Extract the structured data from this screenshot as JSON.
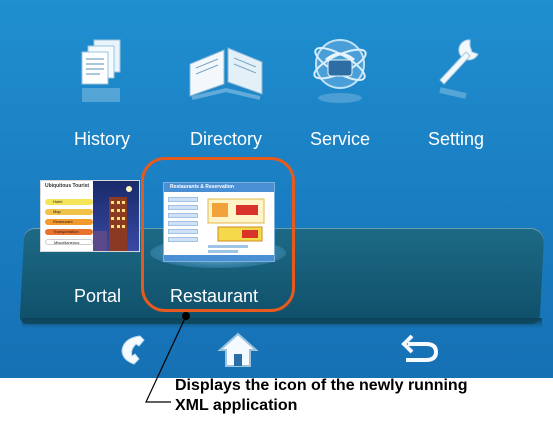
{
  "menu": {
    "items": [
      {
        "label": "History",
        "icon": "documents-stack-icon"
      },
      {
        "label": "Directory",
        "icon": "open-book-icon"
      },
      {
        "label": "Service",
        "icon": "globe-phone-icon"
      },
      {
        "label": "Setting",
        "icon": "wrench-icon"
      }
    ]
  },
  "apps": {
    "portal": {
      "label": "Portal",
      "thumb_title": "Ubiquitous Tourist",
      "thumb_items": [
        "Hotel",
        "Map",
        "Restaurant",
        "Transportation",
        "Miscellaneous"
      ]
    },
    "restaurant": {
      "label": "Restaurant",
      "thumb_title": "Restaurants & Reservation"
    }
  },
  "nav": {
    "icons": [
      "phone-handset-icon",
      "home-icon",
      "back-arrow-icon"
    ]
  },
  "annotation": {
    "line1": "Displays the icon of the newly running",
    "line2": "XML application"
  },
  "colors": {
    "background": "#1b80c4",
    "tray": "#0f4f69",
    "highlight": "#e65a1e"
  }
}
